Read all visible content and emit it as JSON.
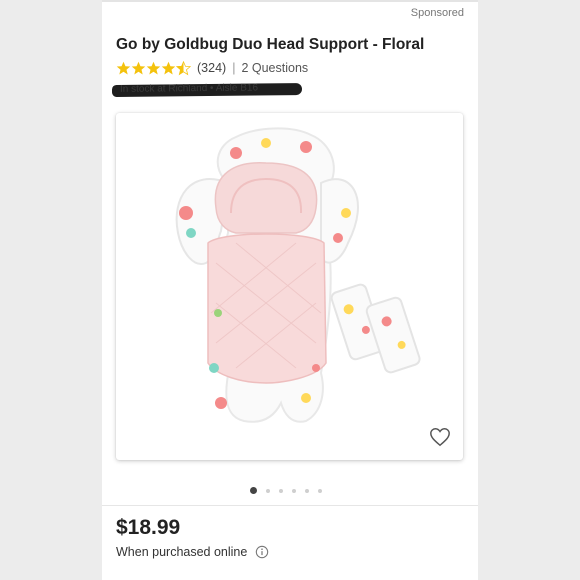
{
  "header": {
    "sponsored": "Sponsored"
  },
  "product": {
    "title": "Go by Goldbug Duo Head Support - Floral",
    "rating_count": "(324)",
    "separator": "|",
    "questions": "2 Questions",
    "rating": 4.5,
    "star_color": "#f4c20d"
  },
  "redacted_text": "In stock at Richland • Aisle B16",
  "gallery": {
    "image_count": 6,
    "active_index": 0
  },
  "pricing": {
    "price": "$18.99",
    "note": "When purchased online"
  },
  "icons": {
    "favorite": "heart-icon",
    "info": "info-icon",
    "star": "star-icon"
  }
}
